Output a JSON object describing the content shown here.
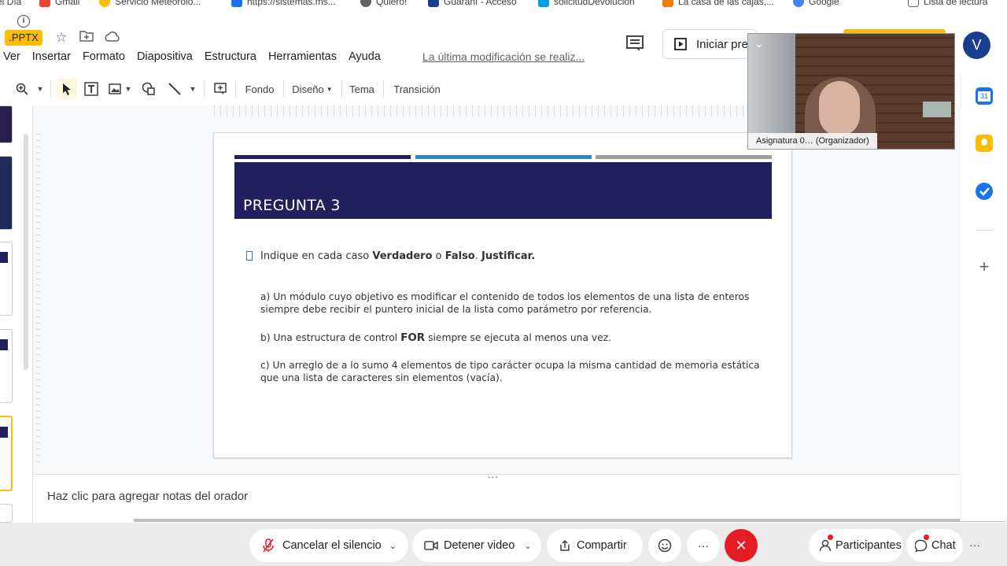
{
  "bookmarks": [
    {
      "label": "el Día",
      "icon": "bookmark-icon",
      "color": "#ffffff"
    },
    {
      "label": "Gmail",
      "icon": "gmail-icon",
      "color": "#ea4335"
    },
    {
      "label": "Servicio Meteorolo...",
      "icon": "google-icon",
      "color": "#fbbc04"
    },
    {
      "label": "https://sistemas.ms...",
      "icon": "flag-icon",
      "color": "#1a73e8"
    },
    {
      "label": "Quiero!",
      "icon": "globe-icon",
      "color": "#5f6368"
    },
    {
      "label": "Guaraní - Acceso",
      "icon": "guarani-icon",
      "color": "#1a3d8f"
    },
    {
      "label": "solicitudDevolucion",
      "icon": "ba-icon",
      "color": "#00a0e3"
    },
    {
      "label": "La casa de las cajas,...",
      "icon": "box-icon",
      "color": "#f57c00"
    },
    {
      "label": "Google",
      "icon": "google-icon",
      "color": "#4285f4"
    },
    {
      "label": "Lista de lectura",
      "icon": "reading-list-icon",
      "color": "#5f6368"
    }
  ],
  "header": {
    "file_badge": ".PPTX",
    "menu": [
      "Ver",
      "Insertar",
      "Formato",
      "Diapositiva",
      "Estructura",
      "Herramientas",
      "Ayuda"
    ],
    "last_edit": "La última modificación se realiz...",
    "present_label": "Iniciar pre",
    "avatar_letter": "V"
  },
  "toolbar": {
    "fondo": "Fondo",
    "diseno": "Diseño",
    "tema": "Tema",
    "transicion": "Transición"
  },
  "slide": {
    "title": "PREGUNTA 3",
    "stripe_colors": [
      "#221f5c",
      "#2e86c1",
      "#9e9e9e"
    ],
    "intro_parts": [
      "Indique en cada caso ",
      "Verdadero",
      " o ",
      "Falso",
      ". ",
      "Justificar."
    ],
    "item_a": "a) Un módulo cuyo objetivo es modificar el contenido de todos los elementos de una lista de enteros siempre debe recibir el puntero inicial de la lista como parámetro por referencia.",
    "item_b_parts": [
      "b) Una estructura de control ",
      "FOR",
      " siempre se ejecuta al menos una vez."
    ],
    "item_c": "c) Un arreglo de a lo sumo 4 elementos de tipo carácter ocupa la misma cantidad de memoria estática que una lista de caracteres sin elementos (vacía)."
  },
  "notes": {
    "placeholder": "Haz clic para agregar notas del orador"
  },
  "video": {
    "caption": "Asignatura 0… (Organizador)"
  },
  "meeting": {
    "mute": "Cancelar el silencio",
    "video": "Detener video",
    "share": "Compartir",
    "more": "···",
    "participants": "Participantes",
    "chat": "Chat"
  }
}
